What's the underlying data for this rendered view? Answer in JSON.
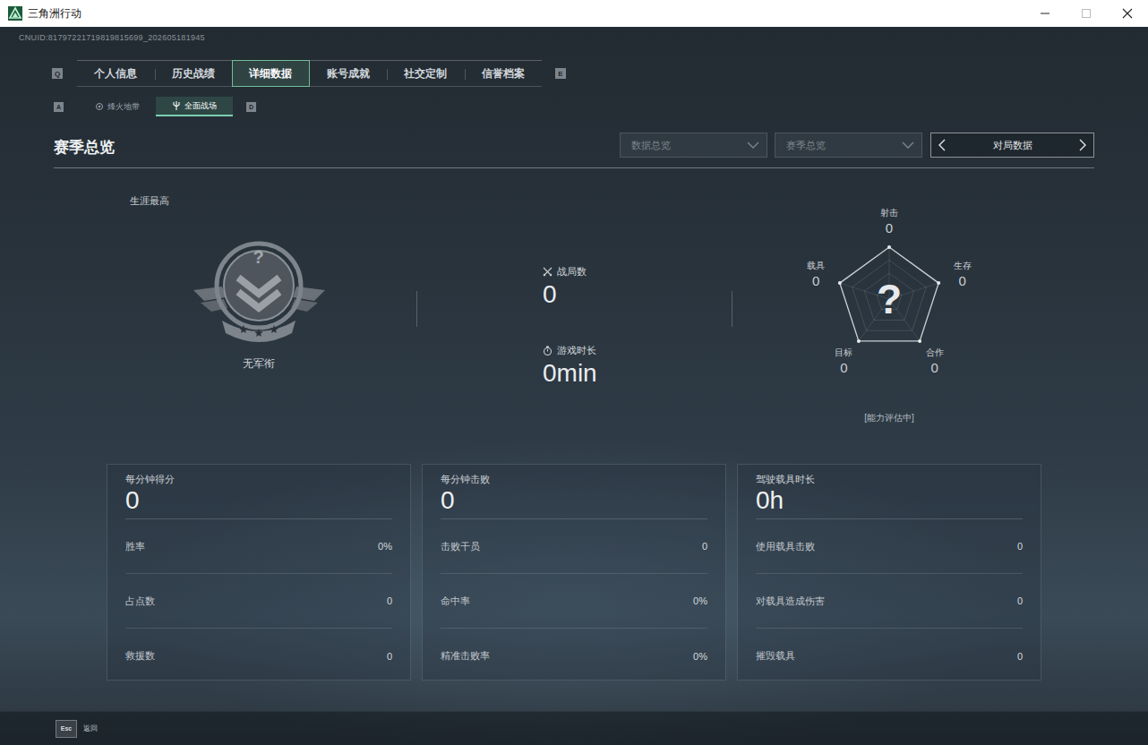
{
  "window": {
    "title": "三角洲行动"
  },
  "uid": "CNUID:81797221719819815699_202605181945",
  "tabs": {
    "prev_key": "Q",
    "next_key": "E",
    "items": [
      {
        "label": "个人信息",
        "selected": false
      },
      {
        "label": "历史战绩",
        "selected": false
      },
      {
        "label": "详细数据",
        "selected": true
      },
      {
        "label": "账号成就",
        "selected": false
      },
      {
        "label": "社交定制",
        "selected": false
      },
      {
        "label": "信誉档案",
        "selected": false
      }
    ]
  },
  "subtabs": {
    "prev_key": "A",
    "next_key": "D",
    "items": [
      {
        "label": "烽火地带",
        "selected": false
      },
      {
        "label": "全面战场",
        "selected": true
      }
    ]
  },
  "section": {
    "title": "赛季总览",
    "filters": [
      {
        "label": "数据总览",
        "disabled": true
      },
      {
        "label": "赛季总览",
        "disabled": true
      }
    ],
    "switcher": {
      "label": "对局数据"
    }
  },
  "career": {
    "label": "生涯最高",
    "badge_mark": "?",
    "rank": "无军衔"
  },
  "summary": [
    {
      "label": "战局数",
      "value": "0"
    },
    {
      "label": "游戏时长",
      "value": "0min"
    }
  ],
  "radar": {
    "center_mark": "?",
    "status": "[能力评估中]",
    "axes": [
      {
        "label": "射击",
        "value": "0"
      },
      {
        "label": "生存",
        "value": "0"
      },
      {
        "label": "合作",
        "value": "0"
      },
      {
        "label": "目标",
        "value": "0"
      },
      {
        "label": "载具",
        "value": "0"
      }
    ]
  },
  "cards": [
    {
      "label": "每分钟得分",
      "value": "0",
      "rows": [
        {
          "label": "胜率",
          "value": "0%"
        },
        {
          "label": "占点数",
          "value": "0"
        },
        {
          "label": "救援数",
          "value": "0"
        }
      ]
    },
    {
      "label": "每分钟击败",
      "value": "0",
      "rows": [
        {
          "label": "击败干员",
          "value": "0"
        },
        {
          "label": "命中率",
          "value": "0%"
        },
        {
          "label": "精准击败率",
          "value": "0%"
        }
      ]
    },
    {
      "label": "驾驶载具时长",
      "value": "0h",
      "rows": [
        {
          "label": "使用载具击败",
          "value": "0"
        },
        {
          "label": "对载具造成伤害",
          "value": "0"
        },
        {
          "label": "摧毁载具",
          "value": "0"
        }
      ]
    }
  ],
  "footer": {
    "key": "Esc",
    "label": "返回"
  }
}
